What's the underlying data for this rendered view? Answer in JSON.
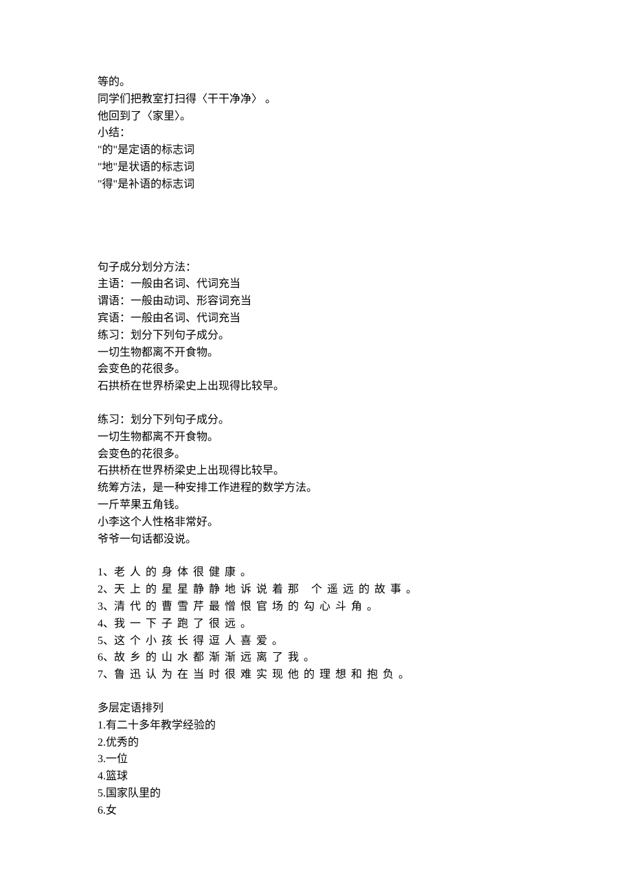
{
  "block1": [
    "等的。",
    "同学们把教室打扫得〈干干净净〉 。",
    "他回到了〈家里〉。",
    "小结：",
    "\"的\"是定语的标志词",
    "\"地\"是状语的标志词",
    "\"得\"是补语的标志词"
  ],
  "block2": [
    "句子成分划分方法：",
    "主语：一般由名词、代词充当",
    "谓语：一般由动词、形容词充当",
    "宾语：一般由名词、代词充当",
    "练习：划分下列句子成分。",
    "一切生物都离不开食物。",
    "会变色的花很多。",
    "石拱桥在世界桥梁史上出现得比较早。"
  ],
  "block3": [
    "练习：划分下列句子成分。",
    "一切生物都离不开食物。",
    "会变色的花很多。",
    "石拱桥在世界桥梁史上出现得比较早。",
    "统筹方法，是一种安排工作进程的数学方法。",
    "一斤苹果五角钱。",
    "小李这个人性格非常好。",
    "爷爷一句话都没说。"
  ],
  "numbered": [
    {
      "prefix": "1、",
      "text": "老人的身体很健康。"
    },
    {
      "prefix": "2、",
      "text": "天上的星星静静地诉说着那 个遥远的故事。"
    },
    {
      "prefix": "3、",
      "text": "清代的曹雪芹最憎恨官场的勾心斗角。"
    },
    {
      "prefix": "4、",
      "text": "我一下子跑了很远。"
    },
    {
      "prefix": "5、",
      "text": "这个小孩长得逗人喜爱。"
    },
    {
      "prefix": "6、",
      "text": "故乡的山水都渐渐远离了我。"
    },
    {
      "prefix": "7、",
      "text": "鲁迅认为在当时很难实现他的理想和抱负。"
    }
  ],
  "block5": [
    "多层定语排列",
    "1.有二十多年教学经验的",
    "2.优秀的",
    "3.一位",
    "4.篮球",
    "5.国家队里的",
    "6.女"
  ]
}
